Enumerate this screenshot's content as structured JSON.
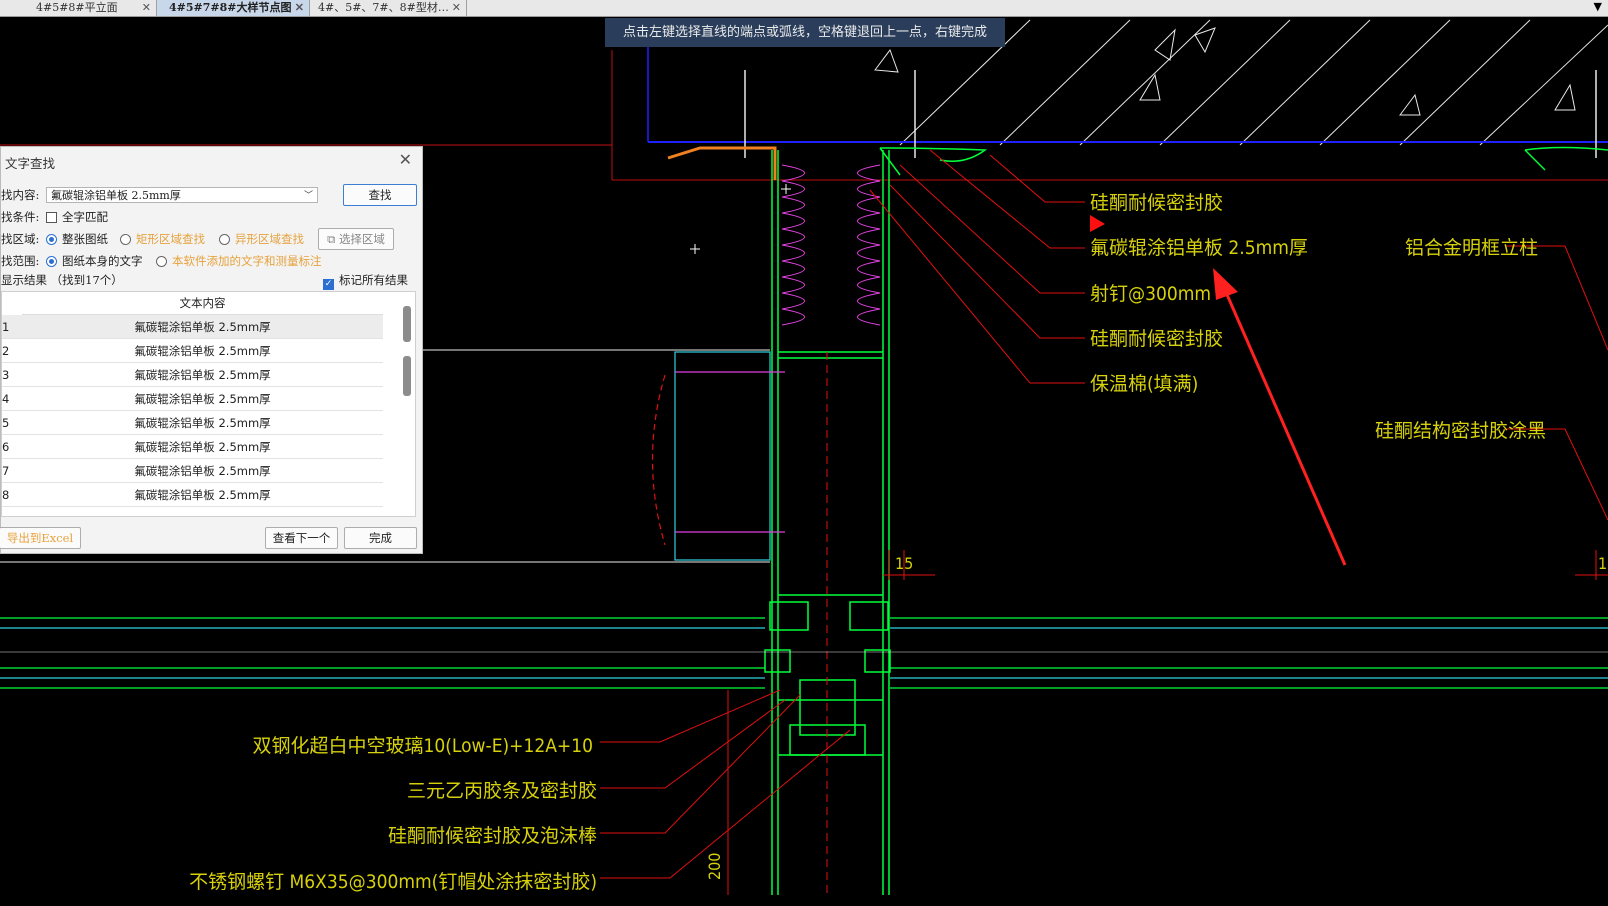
{
  "tabs": [
    {
      "label": "4#5#8#平立面",
      "active": false
    },
    {
      "label": "4#5#7#8#大样节点图",
      "active": true
    },
    {
      "label": "4#、5#、7#、8#型材…",
      "active": false
    }
  ],
  "tab_close": "✕",
  "command_hint": "点击左键选择直线的端点或弧线，空格键退回上一点，右键完成",
  "drawing": {
    "labels_right": [
      "硅酮耐候密封胶",
      "氟碳辊涂铝单板 2.5mm厚",
      "射钉@300mm",
      "硅酮耐候密封胶",
      "保温棉(填满)"
    ],
    "label_column": "铝合金明框立柱",
    "label_structural": "硅酮结构密封胶涂黑",
    "labels_left": [
      "双钢化超白中空玻璃10(Low-E)+12A+10",
      "三元乙丙胶条及密封胶",
      "硅酮耐候密封胶及泡沫棒",
      "不锈钢螺钉 M6X35@300mm(钉帽处涂抹密封胶)"
    ],
    "dim_15": "15",
    "dim_1": "1",
    "dim_200": "200"
  },
  "dialog": {
    "title": "文字查找",
    "close": "✕",
    "content_label": "找内容:",
    "content_value": "氟碳辊涂铝单板 2.5mm厚",
    "find_button": "查找",
    "cond_label": "找条件:",
    "whole_match": "全字匹配",
    "area_label": "找区域:",
    "area_whole": "整张图纸",
    "area_rect": "矩形区域查找",
    "area_irregular": "异形区域查找",
    "select_area": "选择区域",
    "scope_label": "找范围:",
    "scope_drawing": "图纸本身的文字",
    "scope_added": "本软件添加的文字和测量标注",
    "result_label": "显示结果",
    "result_count": "（找到17个）",
    "mark_all": "标记所有结果",
    "column_header": "文本内容",
    "rows": [
      {
        "n": "1",
        "text": "氟碳辊涂铝单板 2.5mm厚"
      },
      {
        "n": "2",
        "text": "氟碳辊涂铝单板 2.5mm厚"
      },
      {
        "n": "3",
        "text": "氟碳辊涂铝单板 2.5mm厚"
      },
      {
        "n": "4",
        "text": "氟碳辊涂铝单板 2.5mm厚"
      },
      {
        "n": "5",
        "text": "氟碳辊涂铝单板 2.5mm厚"
      },
      {
        "n": "6",
        "text": "氟碳辊涂铝单板 2.5mm厚"
      },
      {
        "n": "7",
        "text": "氟碳辊涂铝单板 2.5mm厚"
      },
      {
        "n": "8",
        "text": "氟碳辊涂铝单板 2.5mm厚"
      }
    ],
    "export_button": "导出到Excel",
    "next_button": "查看下一个",
    "done_button": "完成"
  },
  "colors": {
    "cad_text": "#d6d10a",
    "cad_green": "#00ff3a",
    "cad_red": "#e01010",
    "cad_magenta": "#e040e0",
    "cad_blue": "#2020ff",
    "cad_cyan": "#30d0e0",
    "accent": "#2b6fd0"
  }
}
